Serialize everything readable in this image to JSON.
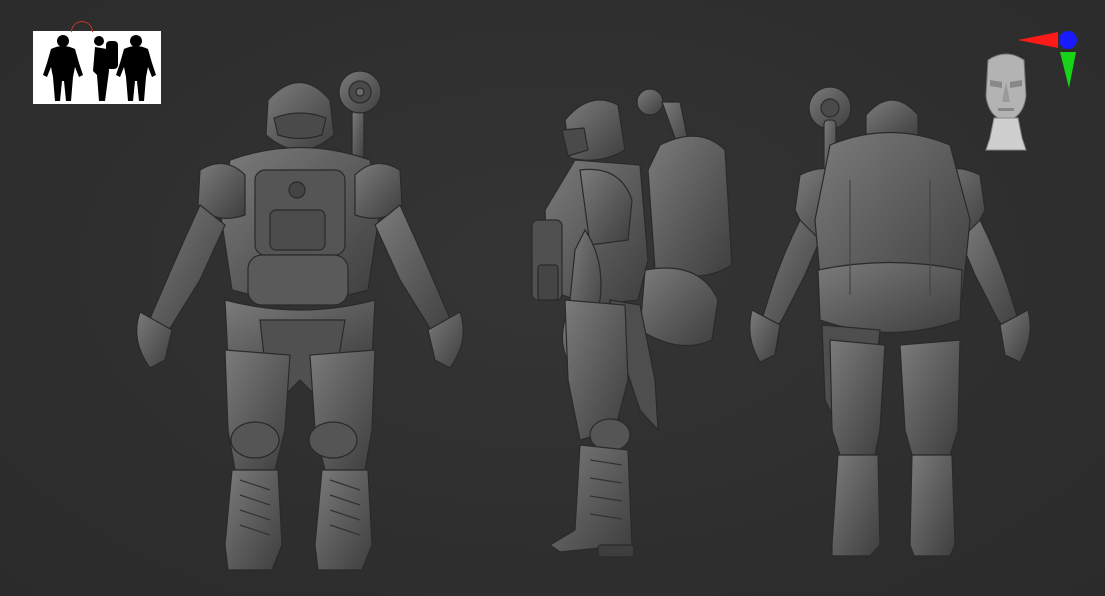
{
  "viewport": {
    "background": "#2f2f2f",
    "model_color": "#5e5e5e",
    "views": [
      "front",
      "side",
      "back"
    ]
  },
  "thumbnail": {
    "background": "#ffffff",
    "silhouette_color": "#000000",
    "marker_color": "#c0392b"
  },
  "gizmo": {
    "x_axis_color": "#ff1a1a",
    "y_axis_color": "#19d319",
    "z_axis_color": "#1a1aff"
  },
  "head_navigator": {
    "icon": "head-icon"
  }
}
